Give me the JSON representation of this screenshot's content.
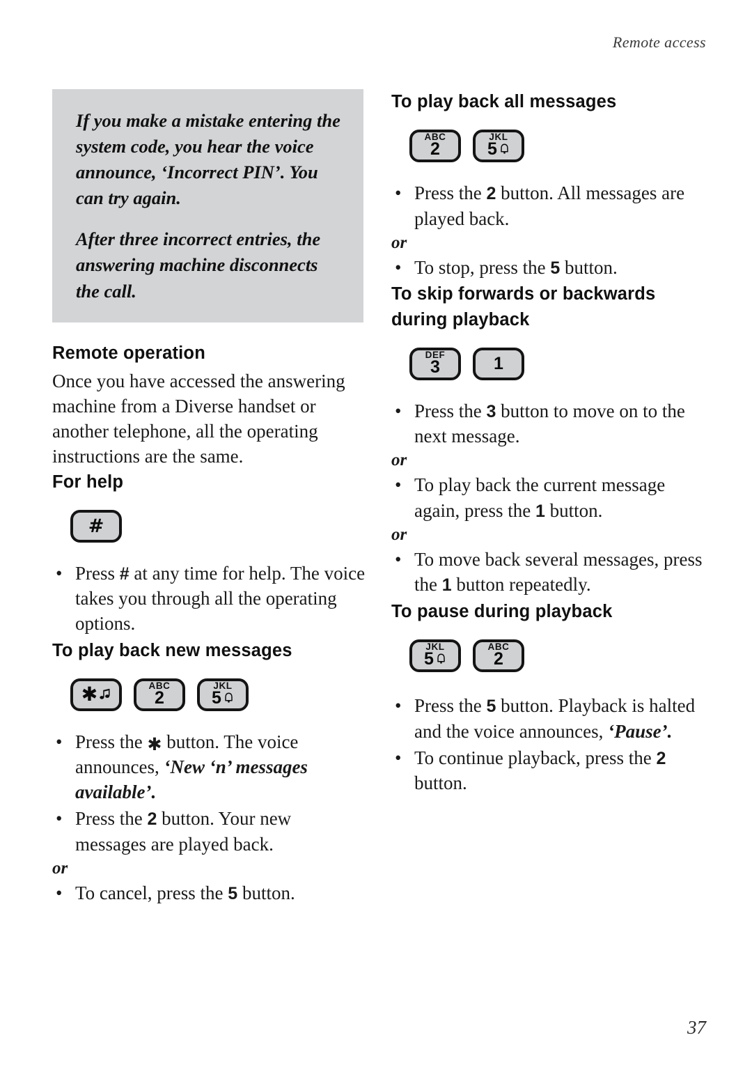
{
  "header": {
    "running_head": "Remote access"
  },
  "footer": {
    "page_number": "37"
  },
  "callout": {
    "paragraph1": "If you make a mistake entering the system code, you hear the voice announce, ‘Incorrect PIN’. You can try again.",
    "paragraph2": "After three incorrect entries, the answering machine disconnects the call."
  },
  "left_column": {
    "section_remote_operation": {
      "heading": "Remote operation",
      "body": "Once you have accessed the answering machine from a Diverse handset or another telephone, all the operating instructions are the same."
    },
    "section_for_help": {
      "heading": "For help",
      "keys": [
        {
          "name": "hash-key",
          "letters": "",
          "glyph": "#",
          "icon": ""
        }
      ],
      "bullets": [
        {
          "prefix": "Press ",
          "key": "#",
          "suffix": " at any time for help. The voice takes you through all the operating options."
        }
      ]
    },
    "section_play_new": {
      "heading": "To play back new messages",
      "keys": [
        {
          "name": "star-key",
          "letters": "",
          "glyph": "✱",
          "icon": "music-note"
        },
        {
          "name": "two-key",
          "letters": "ABC",
          "glyph": "2",
          "icon": ""
        },
        {
          "name": "five-key",
          "letters": "JKL",
          "glyph": "5",
          "icon": "bell"
        }
      ],
      "bullet1_pre": "Press the ",
      "bullet1_key": "✱",
      "bullet1_mid": " button. The voice announces, ",
      "bullet1_voice": "‘New ‘n’ messages available’.",
      "bullet2_pre": "Press the ",
      "bullet2_key": "2",
      "bullet2_suffix": " button. Your new messages are played back.",
      "or_label": "or",
      "bullet3_pre": "To cancel, press the ",
      "bullet3_key": "5",
      "bullet3_suffix": " button."
    }
  },
  "right_column": {
    "section_play_all": {
      "heading": "To play back all messages",
      "keys": [
        {
          "name": "two-key",
          "letters": "ABC",
          "glyph": "2",
          "icon": ""
        },
        {
          "name": "five-key",
          "letters": "JKL",
          "glyph": "5",
          "icon": "bell"
        }
      ],
      "bullet1_pre": "Press the ",
      "bullet1_key": "2",
      "bullet1_suffix": " button. All messages are played back.",
      "or_label": "or",
      "bullet2_pre": "To stop, press the ",
      "bullet2_key": "5",
      "bullet2_suffix": " button."
    },
    "section_skip": {
      "heading": "To skip forwards or backwards during playback",
      "keys": [
        {
          "name": "three-key",
          "letters": "DEF",
          "glyph": "3",
          "icon": ""
        },
        {
          "name": "one-key",
          "letters": "",
          "glyph": "1",
          "icon": ""
        }
      ],
      "bullet1_pre": "Press the ",
      "bullet1_key": "3",
      "bullet1_suffix": " button to move on to the next message.",
      "or_label_1": "or",
      "bullet2_pre": "To play back the current message again, press the ",
      "bullet2_key": "1",
      "bullet2_suffix": " button.",
      "or_label_2": "or",
      "bullet3_pre": "To move back several messages, press the ",
      "bullet3_key": "1",
      "bullet3_suffix": " button repeatedly."
    },
    "section_pause": {
      "heading": "To pause during playback",
      "keys": [
        {
          "name": "five-key",
          "letters": "JKL",
          "glyph": "5",
          "icon": "bell"
        },
        {
          "name": "two-key",
          "letters": "ABC",
          "glyph": "2",
          "icon": ""
        }
      ],
      "bullet1_pre": "Press the ",
      "bullet1_key": "5",
      "bullet1_mid": " button. Playback is halted and the voice announces, ",
      "bullet1_voice": "‘Pause’.",
      "bullet2_pre": "To continue playback, press the ",
      "bullet2_key": "2",
      "bullet2_suffix": " button."
    }
  },
  "bullet_glyph": "•"
}
